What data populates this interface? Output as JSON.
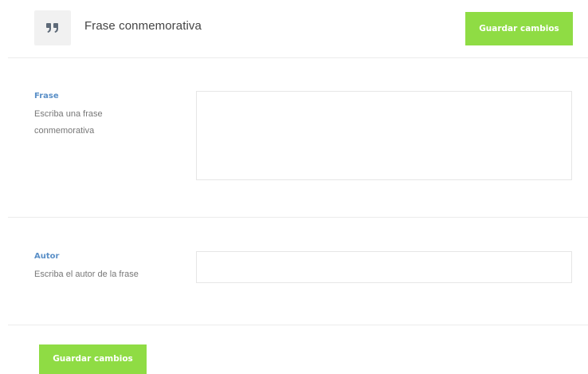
{
  "header": {
    "icon": "quote-icon",
    "title": "Frase conmemorativa",
    "save_label": "Guardar cambios"
  },
  "fields": {
    "frase": {
      "label": "Frase",
      "description": "Escriba una frase conmemorativa",
      "value": ""
    },
    "autor": {
      "label": "Autor",
      "description": "Escriba el autor de la frase",
      "value": ""
    }
  },
  "footer": {
    "save_label": "Guardar cambios"
  },
  "colors": {
    "accent": "#8fdc44",
    "label": "#5a8fc7"
  }
}
